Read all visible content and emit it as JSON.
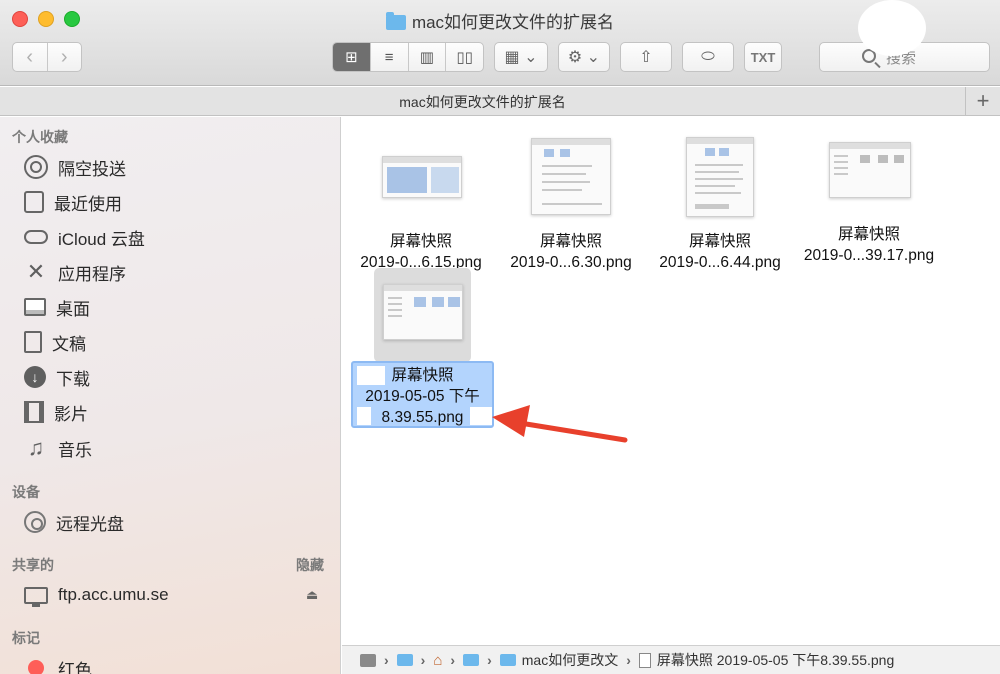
{
  "window": {
    "title": "mac如何更改文件的扩展名"
  },
  "toolbar": {
    "back_glyph": "‹",
    "forward_glyph": "›",
    "view_icons": [
      "⊞",
      "≡",
      "▥",
      "▯▯"
    ],
    "group_glyph": "▦ ⌄",
    "action_glyph": "⚙ ⌄",
    "share_glyph": "⇧",
    "tag_glyph": "⬭",
    "txt_label": "TXT",
    "search_placeholder": "搜索"
  },
  "tab": {
    "title": "mac如何更改文件的扩展名",
    "add_glyph": "+"
  },
  "sidebar": {
    "favorites_header": "个人收藏",
    "favorites": [
      {
        "label": "隔空投送",
        "icon": "airdrop-icon"
      },
      {
        "label": "最近使用",
        "icon": "recents-icon"
      },
      {
        "label": "iCloud 云盘",
        "icon": "cloud-icon"
      },
      {
        "label": "应用程序",
        "icon": "applications-icon"
      },
      {
        "label": "桌面",
        "icon": "desktop-icon"
      },
      {
        "label": "文稿",
        "icon": "documents-icon"
      },
      {
        "label": "下载",
        "icon": "downloads-icon"
      },
      {
        "label": "影片",
        "icon": "movies-icon"
      },
      {
        "label": "音乐",
        "icon": "music-icon"
      }
    ],
    "devices_header": "设备",
    "devices": [
      {
        "label": "远程光盘",
        "icon": "disc-icon"
      }
    ],
    "shared_header": "共享的",
    "shared_hide": "隐藏",
    "shared": [
      {
        "label": "ftp.acc.umu.se",
        "icon": "monitor-icon"
      }
    ],
    "tags_header": "标记",
    "tags": [
      {
        "label": "红色",
        "color": "#fe5e58"
      }
    ]
  },
  "files": [
    {
      "line1": "屏幕快照",
      "line2": "2019-0...6.15.png"
    },
    {
      "line1": "屏幕快照",
      "line2": "2019-0...6.30.png"
    },
    {
      "line1": "屏幕快照",
      "line2": "2019-0...6.44.png"
    },
    {
      "line1": "屏幕快照",
      "line2": "2019-0...39.17.png"
    },
    {
      "line1": "屏幕快照",
      "line2": "2019-05-05 下午",
      "line3": "8.39.55.png",
      "selected": true
    }
  ],
  "pathbar": {
    "folder": "mac如何更改文",
    "file": "屏幕快照 2019-05-05 下午8.39.55.png"
  },
  "colors": {
    "selection": "#b3d4fd",
    "arrow": "#e8402c",
    "folder": "#6cb8ec"
  }
}
